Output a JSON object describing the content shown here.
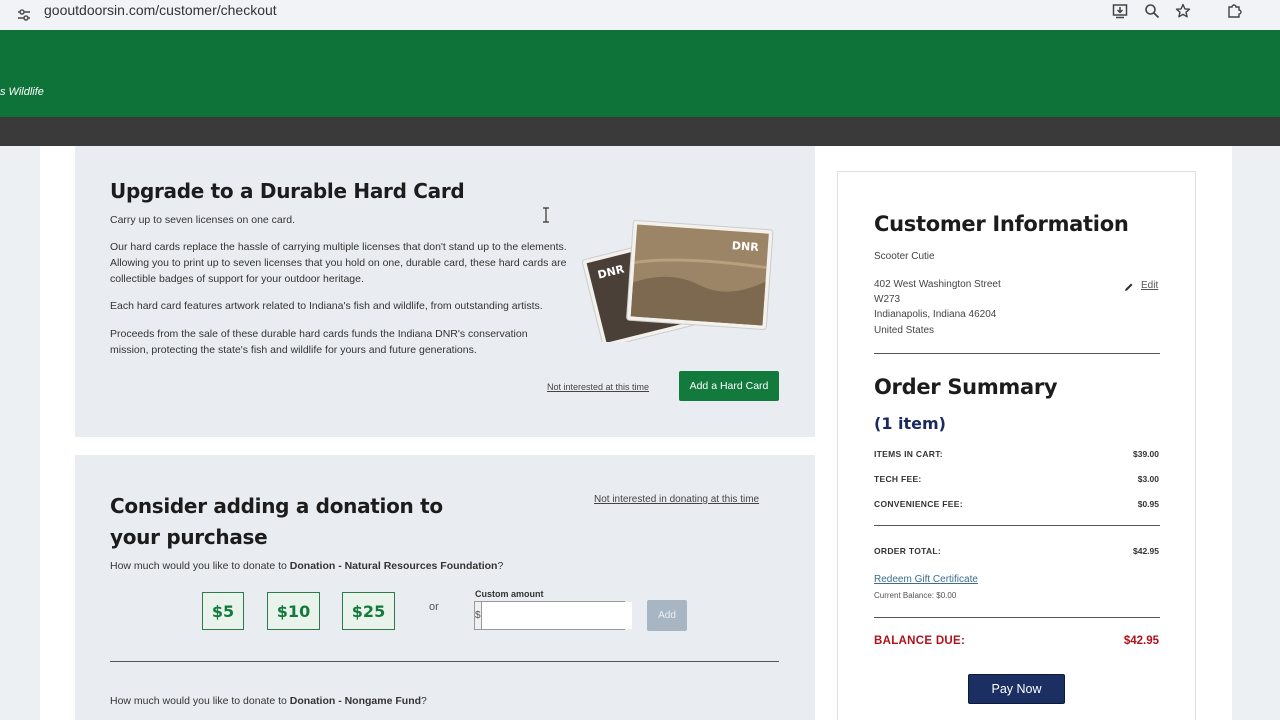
{
  "browser": {
    "url": "gooutdoorsin.com/customer/checkout",
    "tool_icons": [
      "install-icon",
      "zoom-icon",
      "star-icon",
      "extensions-icon"
    ]
  },
  "header": {
    "brand_fragment": "s Wildlife",
    "color": "#0d7339"
  },
  "hard_card": {
    "title": "Upgrade to a Durable Hard Card",
    "p1": "Carry up to seven licenses on one card.",
    "p2": "Our hard cards replace the hassle of carrying multiple licenses that don't stand up to the elements. Allowing you to print up to seven licenses that you hold on one, durable card, these hard cards are collectible badges of support for your outdoor heritage.",
    "p3": "Each hard card features artwork related to Indiana's fish and wildlife, from outstanding artists.",
    "p4": "Proceeds from the sale of these durable hard cards funds the Indiana DNR's conservation mission, protecting the state's fish and wildlife for yours and future generations.",
    "card_logo": "DNR",
    "decline_link": "Not interested at this time",
    "add_button": "Add a Hard Card"
  },
  "donation": {
    "title": "Consider adding a donation to your purchase",
    "decline_link": "Not interested in donating at this time",
    "q1_prefix": "How much would you like to donate to ",
    "q1_name": "Donation - Natural Resources Foundation",
    "q1_suffix": "?",
    "amounts": [
      "$5",
      "$10",
      "$25"
    ],
    "or": "or",
    "custom_label": "Custom amount",
    "currency": "$",
    "custom_value": "",
    "add_button": "Add",
    "q2_prefix": "How much would you like to donate to ",
    "q2_name": "Donation - Nongame Fund",
    "q2_suffix": "?"
  },
  "customer": {
    "title": "Customer Information",
    "name": "Scooter Cutie",
    "address1": "402 West Washington Street",
    "address2": "W273",
    "city_line": "Indianapolis, Indiana  46204",
    "country": "United States",
    "edit_label": "Edit"
  },
  "summary": {
    "title": "Order Summary",
    "count": "(1 item)",
    "items_label": "ITEMS IN CART:",
    "items_value": "$39.00",
    "tech_label": "TECH FEE:",
    "tech_value": "$3.00",
    "conv_label": "CONVENIENCE FEE:",
    "conv_value": "$0.95",
    "total_label": "ORDER TOTAL:",
    "total_value": "$42.95",
    "gift_link": "Redeem Gift Certificate",
    "current_balance": "Current Balance: $0.00",
    "balance_label": "BALANCE DUE:",
    "balance_value": "$42.95",
    "pay_button": "Pay Now"
  }
}
